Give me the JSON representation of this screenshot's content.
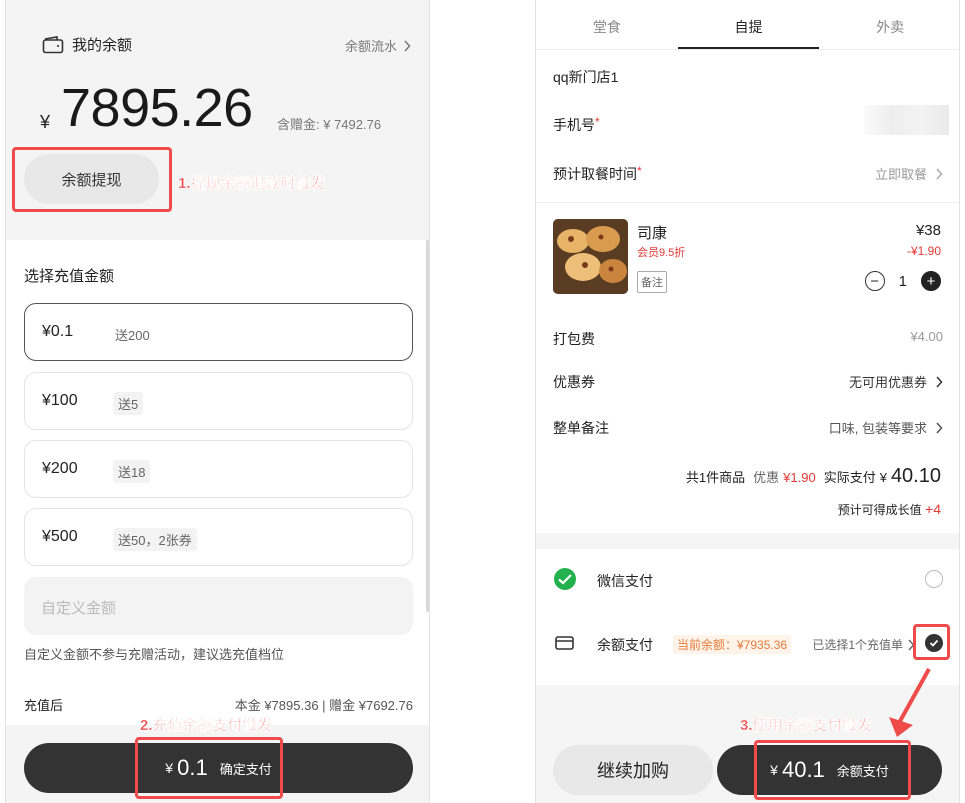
{
  "left": {
    "balance_title": "我的余额",
    "flow_link": "余额流水",
    "currency": "¥",
    "balance": "7895.26",
    "gift_balance": "含赠金: ¥ 7492.76",
    "withdraw_button": "余额提现",
    "recharge_title": "选择充值金额",
    "options": [
      {
        "price": "¥0.1",
        "bonus": "送200"
      },
      {
        "price": "¥100",
        "bonus": "送5"
      },
      {
        "price": "¥200",
        "bonus": "送18"
      },
      {
        "price": "¥500",
        "bonus": "送50，2张券"
      }
    ],
    "custom_placeholder": "自定义金额",
    "custom_note": "自定义金额不参与充赠活动，建议选充值档位",
    "after_label": "充值后",
    "after_value": "本金 ¥7895.36 | 赠金 ¥7692.76",
    "pay_currency": "¥",
    "pay_amount": "0.1",
    "pay_label": "确定支付"
  },
  "right": {
    "tabs": [
      "堂食",
      "自提",
      "外卖"
    ],
    "active_tab": 1,
    "store_name": "qq新门店1",
    "phone_label": "手机号",
    "required_mark": "*",
    "pickup_label": "预计取餐时间",
    "pickup_value": "立即取餐",
    "item": {
      "name": "司康",
      "member_tag": "会员9.5折",
      "note_tag": "备注",
      "price": "¥38",
      "discount": "-¥1.90",
      "qty": "1",
      "minus": "−",
      "plus": "+"
    },
    "packing_label": "打包费",
    "packing_value": "¥4.00",
    "coupon_label": "优惠券",
    "coupon_value": "无可用优惠券",
    "remark_label": "整单备注",
    "remark_value": "口味, 包装等要求",
    "summary": {
      "count": "共1件商品",
      "discount_label": "优惠",
      "discount_value": "¥1.90",
      "actual_label": "实际支付",
      "actual_currency": "¥",
      "actual_value": "40.10"
    },
    "growth_label": "预计可得成长值",
    "growth_value": "+4",
    "wechat_pay": "微信支付",
    "balance_pay": "余额支付",
    "current_balance": "当前余额：¥7935.36",
    "selected_card": "已选择1个充值单",
    "continue_button": "继续加购",
    "pay_currency": "¥",
    "pay_amount": "40.1",
    "pay_label": "余额支付"
  },
  "annotations": {
    "a1": "1.提现余额退款时触发",
    "a2": "2.充值余额支付触发",
    "a3": "3.使用余额支付触发",
    "color": "#ef4b4b"
  }
}
